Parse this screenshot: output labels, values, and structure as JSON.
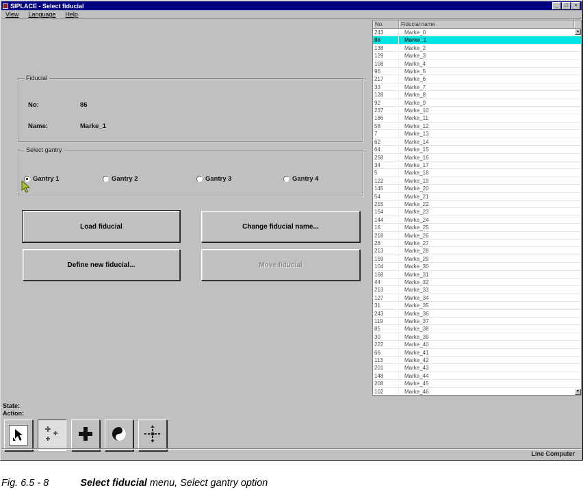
{
  "window": {
    "title": "SIPLACE - Select fiducial",
    "menu": {
      "view": "View",
      "language": "Language",
      "help": "Help"
    },
    "title_buttons": {
      "minimize": "_",
      "maximize": "□",
      "close": "×"
    }
  },
  "fiducial_panel": {
    "group_label": "Fiducial",
    "no_label": "No:",
    "no_value": "86",
    "name_label": "Name:",
    "name_value": "Marke_1"
  },
  "gantry_panel": {
    "group_label": "Select gantry",
    "options": [
      {
        "label": "Gantry 1",
        "selected": true
      },
      {
        "label": "Gantry 2",
        "selected": false
      },
      {
        "label": "Gantry 3",
        "selected": false
      },
      {
        "label": "Gantry 4",
        "selected": false
      }
    ]
  },
  "buttons": {
    "load": "Load fiducial",
    "change_name": "Change fiducial name...",
    "define_new": "Define new fiducial...",
    "move": "Move fiducial",
    "move_disabled": true
  },
  "fiducial_list": {
    "columns": [
      "No.",
      "Fiducial name"
    ],
    "selected_index": 1,
    "scroll_up_glyph": "▴",
    "scroll_down_glyph": "▾",
    "rows": [
      [
        "243",
        "Marke_0"
      ],
      [
        "86",
        "Marke_1"
      ],
      [
        "138",
        "Marke_2"
      ],
      [
        "129",
        "Marke_3"
      ],
      [
        "108",
        "Marke_4"
      ],
      [
        "96",
        "Marke_5"
      ],
      [
        "217",
        "Marke_6"
      ],
      [
        "33",
        "Marke_7"
      ],
      [
        "128",
        "Marke_8"
      ],
      [
        "92",
        "Marke_9"
      ],
      [
        "237",
        "Marke_10"
      ],
      [
        "186",
        "Marke_11"
      ],
      [
        "58",
        "Marke_12"
      ],
      [
        "7",
        "Marke_13"
      ],
      [
        "62",
        "Marke_14"
      ],
      [
        "64",
        "Marke_15"
      ],
      [
        "258",
        "Marke_16"
      ],
      [
        "34",
        "Marke_17"
      ],
      [
        "5",
        "Marke_18"
      ],
      [
        "122",
        "Marke_19"
      ],
      [
        "145",
        "Marke_20"
      ],
      [
        "54",
        "Marke_21"
      ],
      [
        "215",
        "Marke_22"
      ],
      [
        "154",
        "Marke_23"
      ],
      [
        "144",
        "Marke_24"
      ],
      [
        "16",
        "Marke_25"
      ],
      [
        "218",
        "Marke_26"
      ],
      [
        "28",
        "Marke_27"
      ],
      [
        "213",
        "Marke_28"
      ],
      [
        "159",
        "Marke_29"
      ],
      [
        "104",
        "Marke_30"
      ],
      [
        "168",
        "Marke_31"
      ],
      [
        "44",
        "Marke_32"
      ],
      [
        "213",
        "Marke_33"
      ],
      [
        "127",
        "Marke_34"
      ],
      [
        "31",
        "Marke_35"
      ],
      [
        "243",
        "Marke_36"
      ],
      [
        "119",
        "Marke_37"
      ],
      [
        "85",
        "Marke_38"
      ],
      [
        "30",
        "Marke_39"
      ],
      [
        "222",
        "Marke_40"
      ],
      [
        "66",
        "Marke_41"
      ],
      [
        "113",
        "Marke_42"
      ],
      [
        "201",
        "Marke_43"
      ],
      [
        "148",
        "Marke_44"
      ],
      [
        "208",
        "Marke_45"
      ],
      [
        "102",
        "Marke_46"
      ]
    ]
  },
  "status": {
    "state_label": "State:",
    "action_label": "Action:",
    "line_label": "Line Computer"
  },
  "toolbar": {
    "buttons": [
      {
        "icon": "select-arrow-icon",
        "pressed": false
      },
      {
        "icon": "fiducial-marks-icon",
        "pressed": true
      },
      {
        "icon": "crosshair-icon",
        "pressed": false
      },
      {
        "icon": "camera-circle-icon",
        "pressed": false
      },
      {
        "icon": "align-move-icon",
        "pressed": false
      }
    ]
  },
  "caption": {
    "fig": "Fig. 6.5 - 8",
    "title_bold": "Select fiducial",
    "rest": " menu, Select gantry option"
  },
  "colors": {
    "titlebar": "#000080",
    "window_bg": "#c0c0c0",
    "highlight": "#00e4e4"
  }
}
